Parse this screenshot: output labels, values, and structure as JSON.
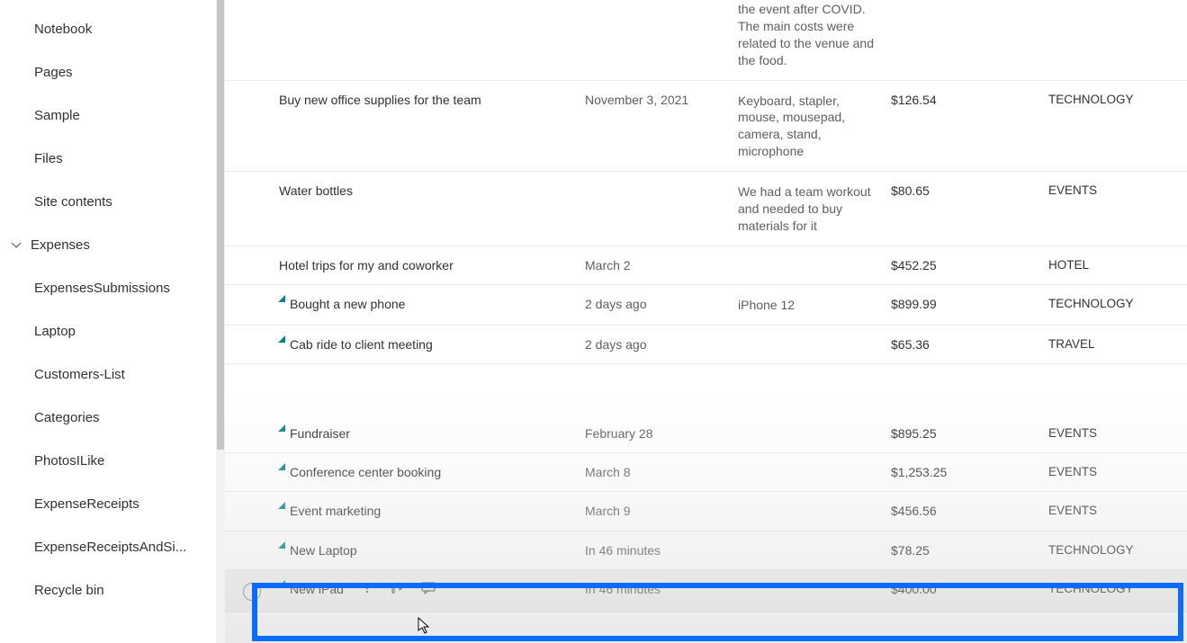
{
  "sidebar": {
    "items": [
      {
        "label": "Notebook"
      },
      {
        "label": "Pages"
      },
      {
        "label": "Sample"
      },
      {
        "label": "Files"
      },
      {
        "label": "Site contents"
      }
    ],
    "section": {
      "label": "Expenses"
    },
    "subitems": [
      {
        "label": "ExpensesSubmissions"
      },
      {
        "label": "Laptop"
      },
      {
        "label": "Customers-List"
      },
      {
        "label": "Categories"
      },
      {
        "label": "PhotosILike"
      },
      {
        "label": "ExpenseReceipts"
      },
      {
        "label": "ExpenseReceiptsAndSi..."
      },
      {
        "label": "Recycle bin"
      }
    ]
  },
  "rows": [
    {
      "title": "",
      "date": "",
      "desc": "the event after COVID. The main costs were related to the venue and the food.",
      "amount": "",
      "category": "",
      "new": false,
      "partial_top": true
    },
    {
      "title": "Buy new office supplies for the team",
      "date": "November 3, 2021",
      "desc": "Keyboard, stapler, mouse, mousepad, camera, stand, microphone",
      "amount": "$126.54",
      "category": "TECHNOLOGY",
      "new": false
    },
    {
      "title": "Water bottles",
      "date": "",
      "desc": "We had a team workout and needed to buy materials for it",
      "amount": "$80.65",
      "category": "EVENTS",
      "new": false
    },
    {
      "title": "Hotel trips for my and coworker",
      "date": "March 2",
      "desc": "",
      "amount": "$452.25",
      "category": "HOTEL",
      "new": false
    },
    {
      "title": "Bought a new phone",
      "date": "2 days ago",
      "desc": "iPhone 12",
      "amount": "$899.99",
      "category": "TECHNOLOGY",
      "new": true
    },
    {
      "title": "Cab ride to client meeting",
      "date": "2 days ago",
      "desc": "",
      "amount": "$65.36",
      "category": "TRAVEL",
      "new": true
    },
    {
      "gap": true
    },
    {
      "title": "Fundraiser",
      "date": "February 28",
      "desc": "",
      "amount": "$895.25",
      "category": "EVENTS",
      "new": true
    },
    {
      "title": "Conference center booking",
      "date": "March 8",
      "desc": "",
      "amount": "$1,253.25",
      "category": "EVENTS",
      "new": true
    },
    {
      "title": "Event marketing",
      "date": "March 9",
      "desc": "",
      "amount": "$456.56",
      "category": "EVENTS",
      "new": true
    },
    {
      "title": "New Laptop",
      "date": "In 46 minutes",
      "desc": "",
      "amount": "$78.25",
      "category": "TECHNOLOGY",
      "new": true
    },
    {
      "title": "New iPad",
      "date": "In 46 minutes",
      "desc": "",
      "amount": "$400.00",
      "category": "TECHNOLOGY",
      "new": true,
      "hovered": true
    }
  ]
}
